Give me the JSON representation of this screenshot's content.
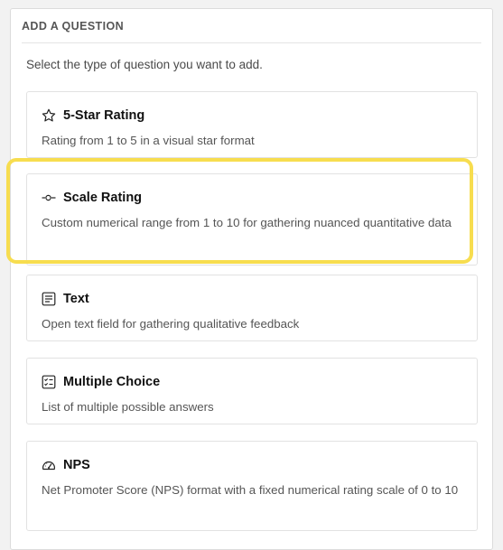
{
  "panel": {
    "title": "ADD A QUESTION",
    "intro": "Select the type of question you want to add."
  },
  "highlight_color": "#f7dd4f",
  "question_types": [
    {
      "icon": "star-icon",
      "title": "5-Star Rating",
      "description": "Rating from 1 to 5 in a visual star format"
    },
    {
      "icon": "scale-icon",
      "title": "Scale Rating",
      "description": "Custom numerical range from 1 to 10 for gathering nuanced quantitative data",
      "highlighted": true
    },
    {
      "icon": "text-icon",
      "title": "Text",
      "description": "Open text field for gathering qualitative feedback"
    },
    {
      "icon": "checklist-icon",
      "title": "Multiple Choice",
      "description": "List of multiple possible answers"
    },
    {
      "icon": "gauge-icon",
      "title": "NPS",
      "description": "Net Promoter Score (NPS) format with a fixed numerical rating scale of 0 to 10"
    }
  ]
}
